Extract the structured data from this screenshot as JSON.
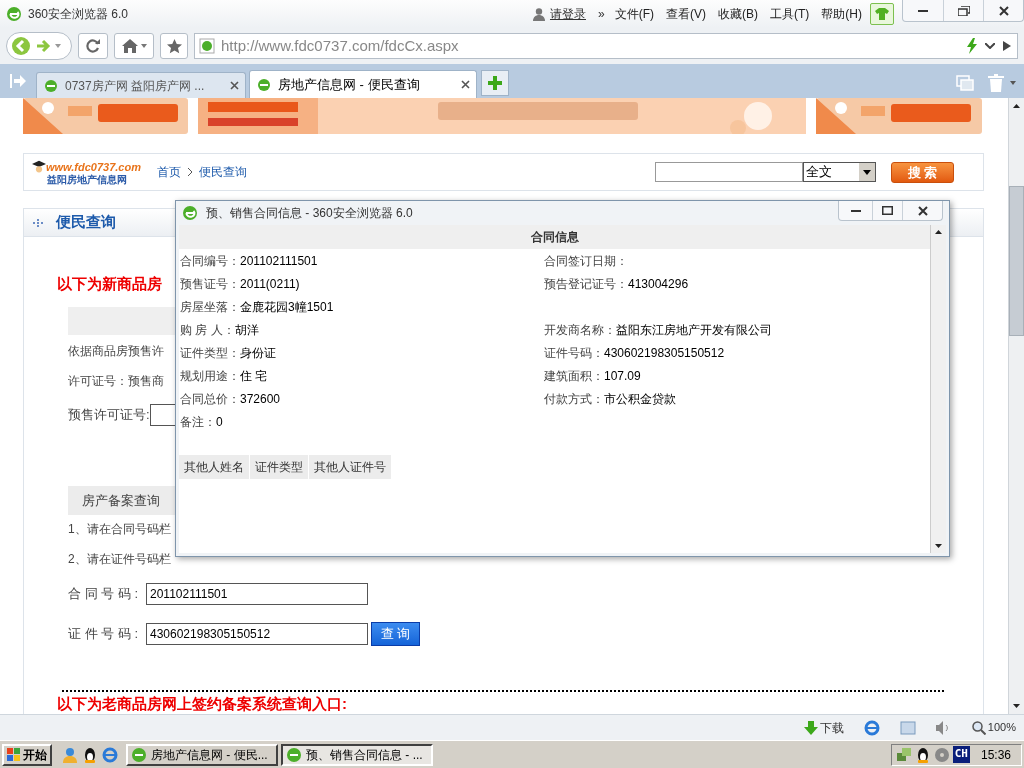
{
  "browser": {
    "title": "360安全浏览器 6.0",
    "login": "请登录",
    "more": "»",
    "menus": [
      "文件(F)",
      "查看(V)",
      "收藏(B)",
      "工具(T)",
      "帮助(H)"
    ],
    "address": "http://www.fdc0737.com/fdcCx.aspx",
    "tabs": [
      {
        "label": "0737房产网 益阳房产网 ...",
        "selected": false
      },
      {
        "label": "房地产信息网 - 便民查询",
        "selected": true
      }
    ]
  },
  "page": {
    "logo": {
      "url": "www.fdc0737.com",
      "name": "益阳房地产信息网"
    },
    "breadcrumb": [
      "首页",
      "便民查询"
    ],
    "search_scope": "全文",
    "search_button": "搜 索",
    "section_title": "便民查询",
    "new_heading": "以下为新商品房",
    "notes": [
      "依据商品房预售许",
      "许可证号：预售商"
    ],
    "presale_label": "预售许可证号:",
    "query_tab": "房产备案查询",
    "instructions": [
      "1、请在合同号码栏",
      "2、请在证件号码栏"
    ],
    "fields": [
      {
        "label": "合 同 号 码 :",
        "value": "201102111501"
      },
      {
        "label": "证 件 号 码 :",
        "value": "430602198305150512"
      }
    ],
    "query_button": "查 询",
    "old_heading": "以下为老商品房网上签约备案系统查询入口:"
  },
  "popup": {
    "title": "预、销售合同信息 - 360安全浏览器 6.0",
    "heading": "合同信息",
    "rows": [
      [
        {
          "label": "合同编号：",
          "value": "201102111501"
        },
        {
          "label": "合同签订日期："
        }
      ],
      [
        {
          "label": "预售证号：",
          "value": "2011(0211)"
        },
        {
          "label": "预告登记证号：",
          "value": "413004296"
        }
      ],
      [
        {
          "label": "房屋坐落：",
          "value": "金鹿花园3幢1501"
        }
      ],
      [
        {
          "label": "购 房 人：",
          "value": "胡洋"
        },
        {
          "label": "开发商名称：",
          "value": "益阳东江房地产开发有限公司"
        }
      ],
      [
        {
          "label": "证件类型：",
          "value": "身份证"
        },
        {
          "label": "证件号码：",
          "value": "430602198305150512"
        }
      ],
      [
        {
          "label": "规划用途：",
          "value": "住 宅"
        },
        {
          "label": "建筑面积：",
          "value": "107.09"
        }
      ],
      [
        {
          "label": "合同总价：",
          "value": "372600"
        },
        {
          "label": "付款方式：",
          "value": "市公积金贷款"
        }
      ],
      [
        {
          "label": "备注：",
          "value": "0"
        }
      ]
    ],
    "table_columns": [
      "其他人姓名",
      "证件类型",
      "其他人证件号"
    ]
  },
  "status_bar": {
    "download": "下载",
    "zoom": "100%"
  },
  "taskbar": {
    "start": "开始",
    "tasks": [
      {
        "label": "房地产信息网 - 便民...",
        "selected": false
      },
      {
        "label": "预、销售合同信息 - ...",
        "selected": true
      }
    ],
    "ime": "CH",
    "clock": "15:36"
  }
}
